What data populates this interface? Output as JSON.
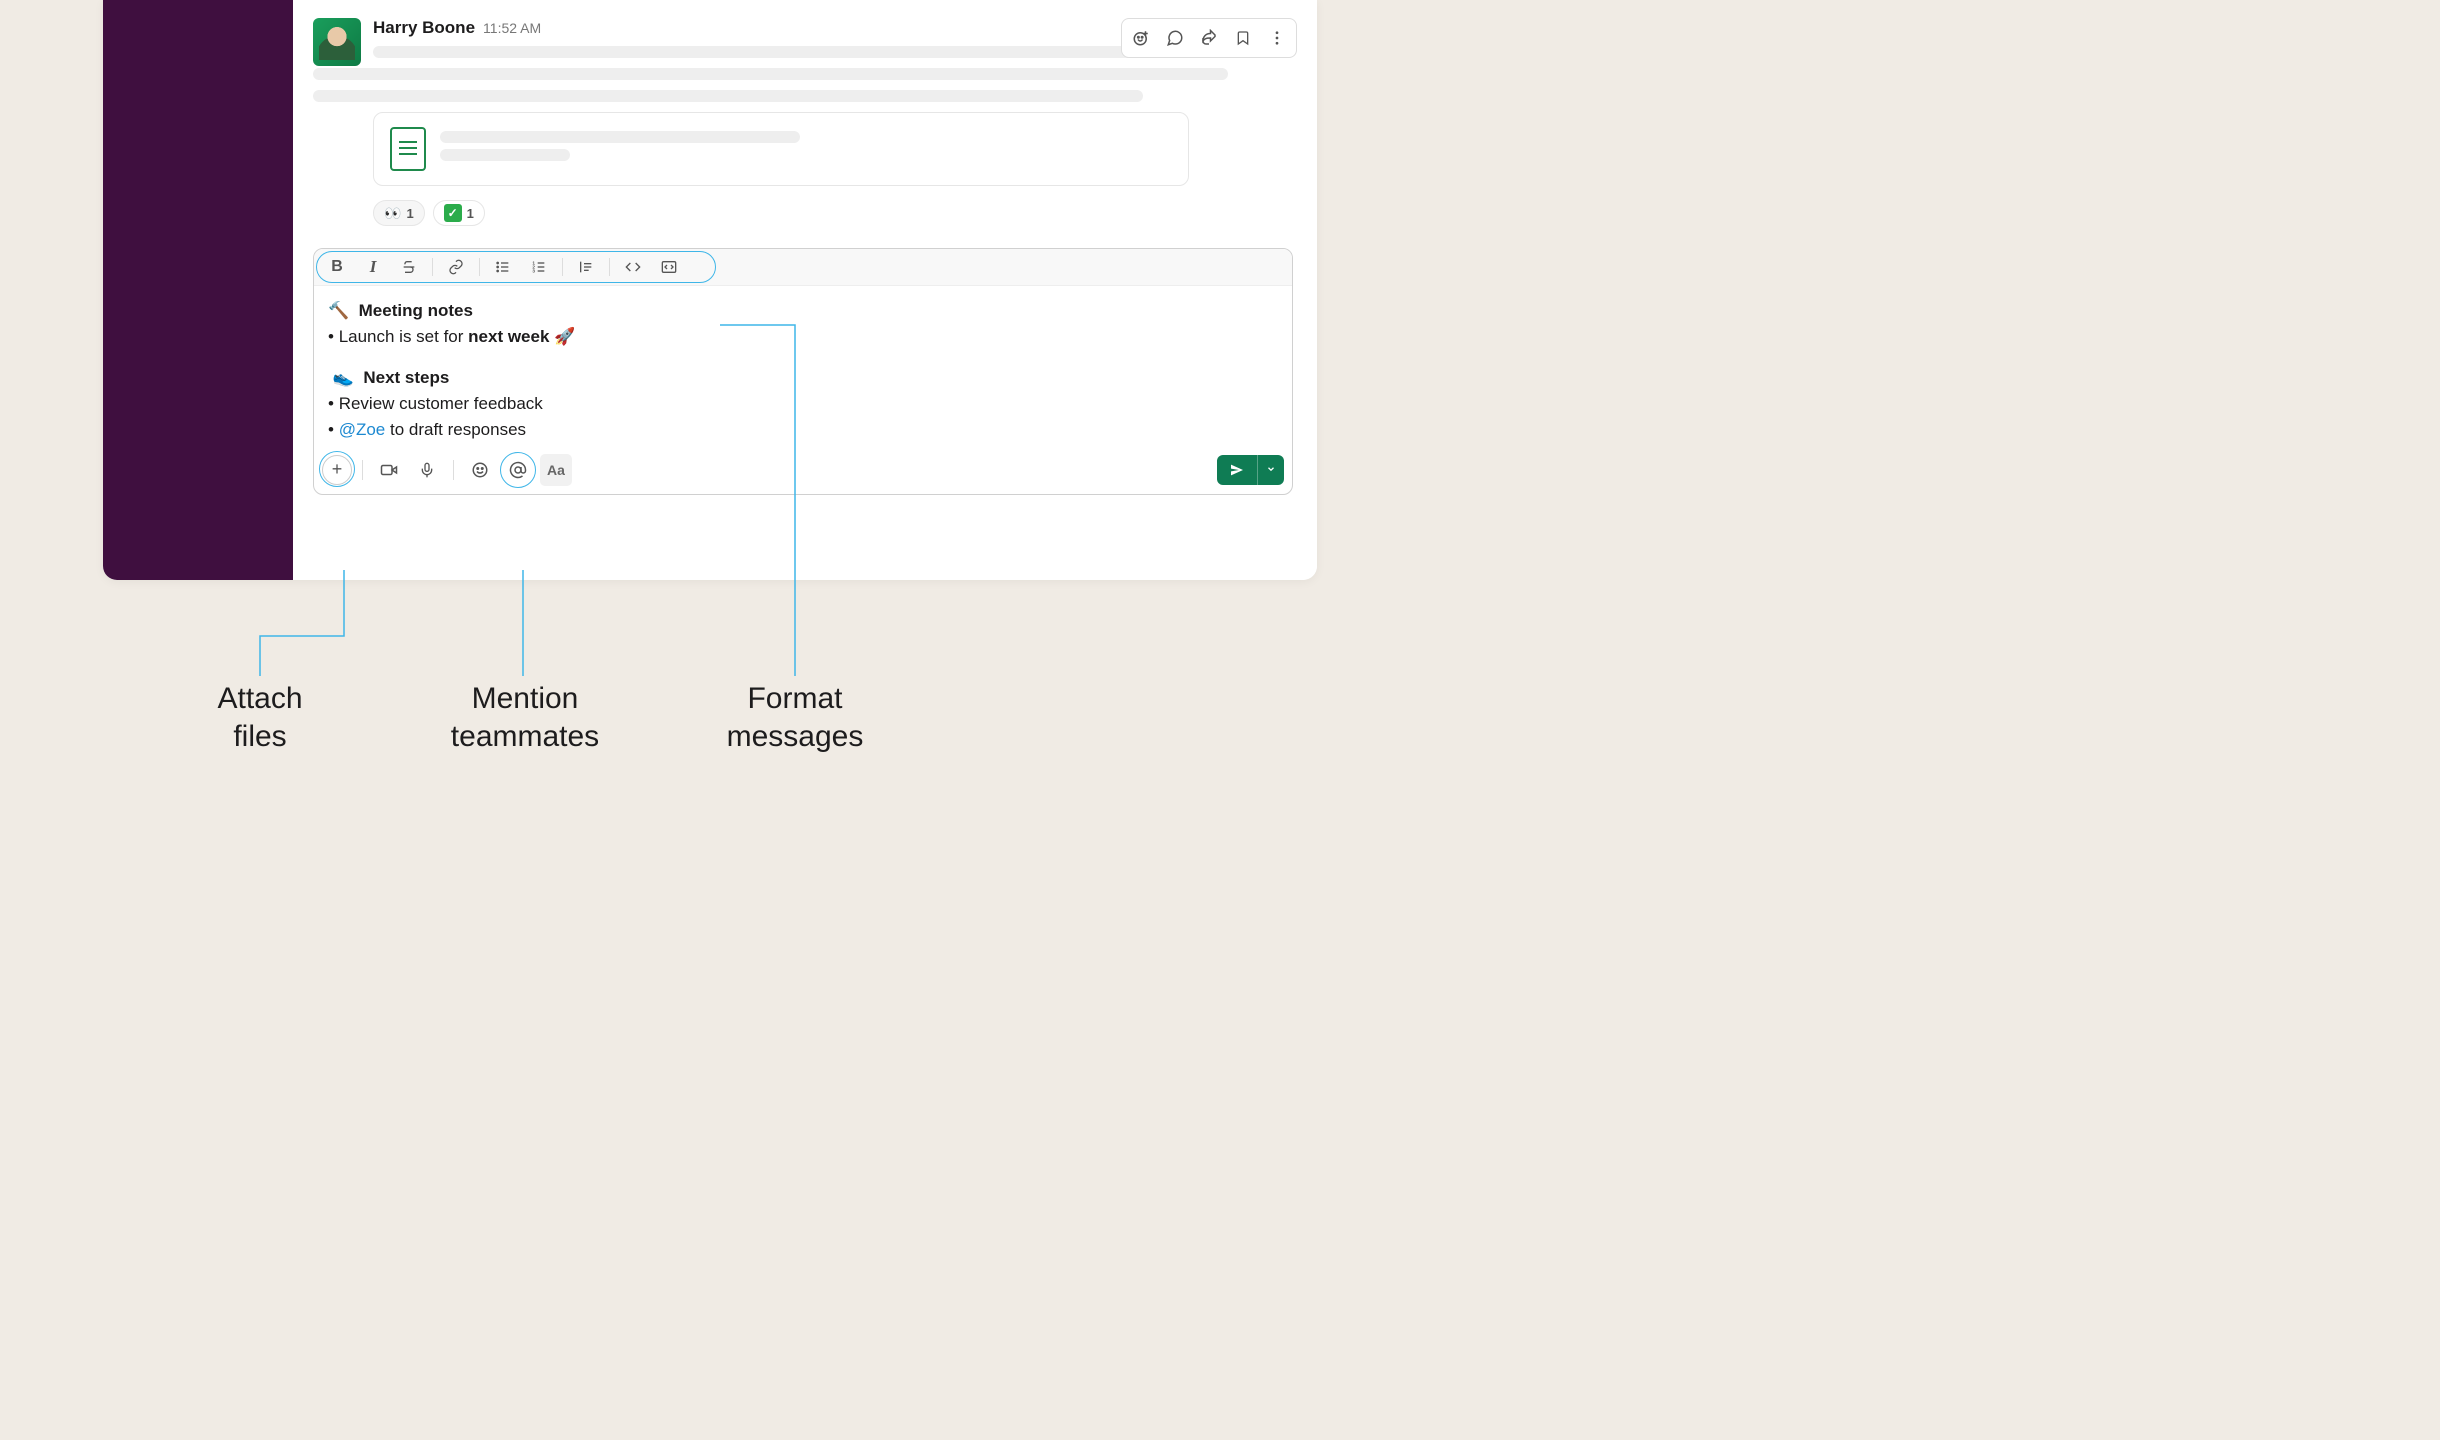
{
  "message": {
    "author": "Harry Boone",
    "time": "11:52 AM"
  },
  "reactions": {
    "eyes_count": "1",
    "check_count": "1"
  },
  "composer": {
    "heading1": "Meeting notes",
    "bullet1_pre": "Launch is set for ",
    "bullet1_strong": "next week",
    "heading2": "Next steps",
    "bullet2": "Review customer feedback",
    "bullet3_mention": "@Zoe",
    "bullet3_rest": " to draft responses",
    "aa_label": "Aa"
  },
  "emoji": {
    "gavel": "🔨",
    "rocket": "🚀",
    "shoe": "👟",
    "eyes": "👀",
    "check": "✓"
  },
  "callouts": {
    "attach": "Attach\nfiles",
    "mention": "Mention\nteammates",
    "format": "Format\nmessages"
  }
}
